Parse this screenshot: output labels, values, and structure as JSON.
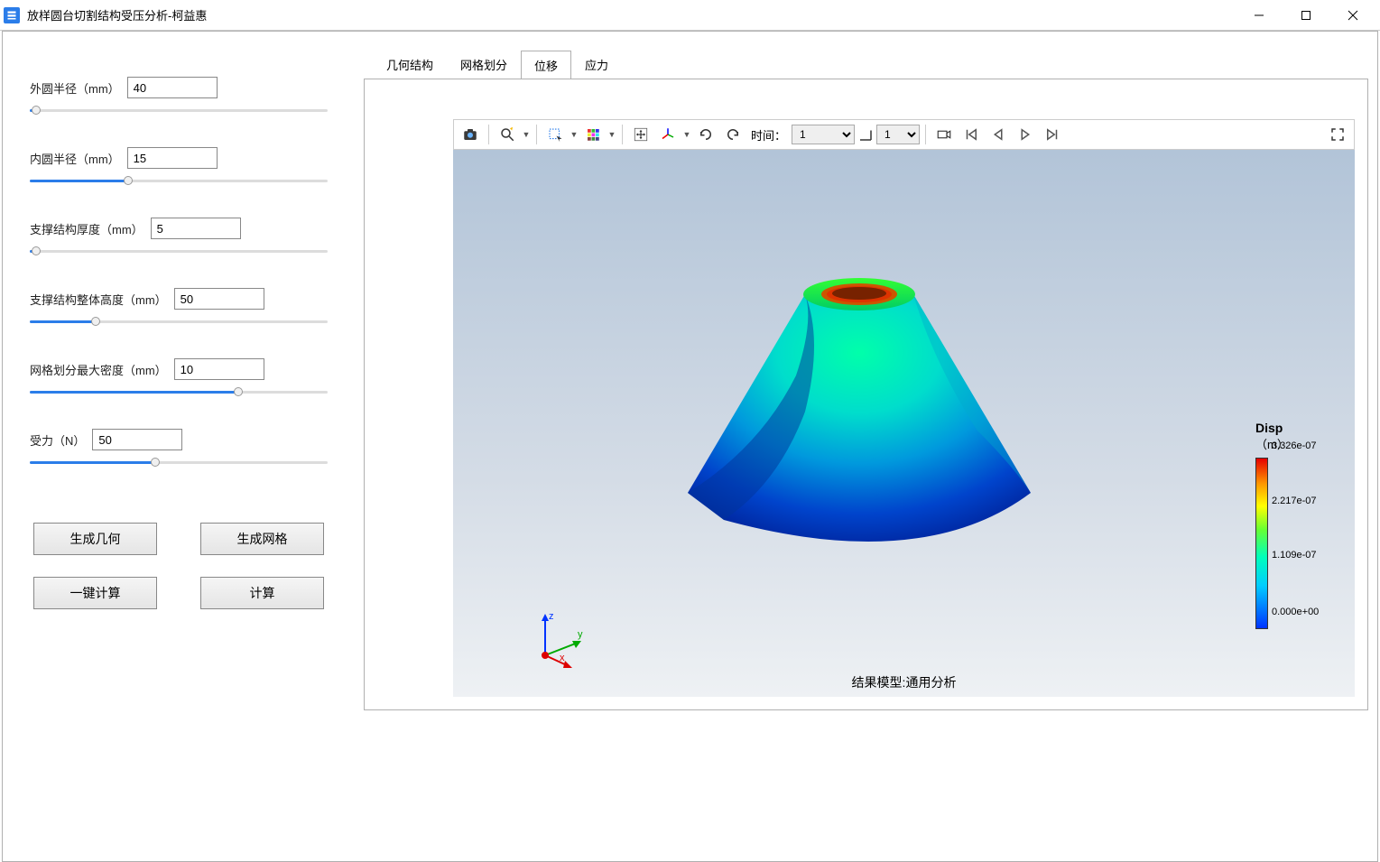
{
  "window": {
    "title": "放样圆台切割结构受压分析-柯益惠"
  },
  "params": [
    {
      "label": "外圆半径（mm）",
      "value": "40",
      "fill_pct": 2
    },
    {
      "label": "内圆半径（mm）",
      "value": "15",
      "fill_pct": 33
    },
    {
      "label": "支撑结构厚度（mm）",
      "value": "5",
      "fill_pct": 2
    },
    {
      "label": "支撑结构整体高度（mm）",
      "value": "50",
      "fill_pct": 22
    },
    {
      "label": "网格划分最大密度（mm）",
      "value": "10",
      "fill_pct": 70
    },
    {
      "label": "受力（N）",
      "value": "50",
      "fill_pct": 42
    }
  ],
  "buttons": {
    "gen_geom": "生成几何",
    "gen_mesh": "生成网格",
    "one_click": "一键计算",
    "compute": "计算"
  },
  "tabs": [
    {
      "label": "几何结构",
      "active": false
    },
    {
      "label": "网格划分",
      "active": false
    },
    {
      "label": "位移",
      "active": true
    },
    {
      "label": "应力",
      "active": false
    }
  ],
  "toolbar": {
    "time_label": "时间：",
    "time_value": "1",
    "frame_value": "1"
  },
  "legend": {
    "title": "Disp",
    "unit": "（m）",
    "ticks": [
      {
        "label": "3.326e-07",
        "pct": 0
      },
      {
        "label": "2.217e-07",
        "pct": 33
      },
      {
        "label": "1.109e-07",
        "pct": 66
      },
      {
        "label": "0.000e+00",
        "pct": 100
      }
    ]
  },
  "viewport": {
    "result_label": "结果模型:通用分析",
    "axes": {
      "x": "x",
      "y": "y",
      "z": "z"
    }
  }
}
